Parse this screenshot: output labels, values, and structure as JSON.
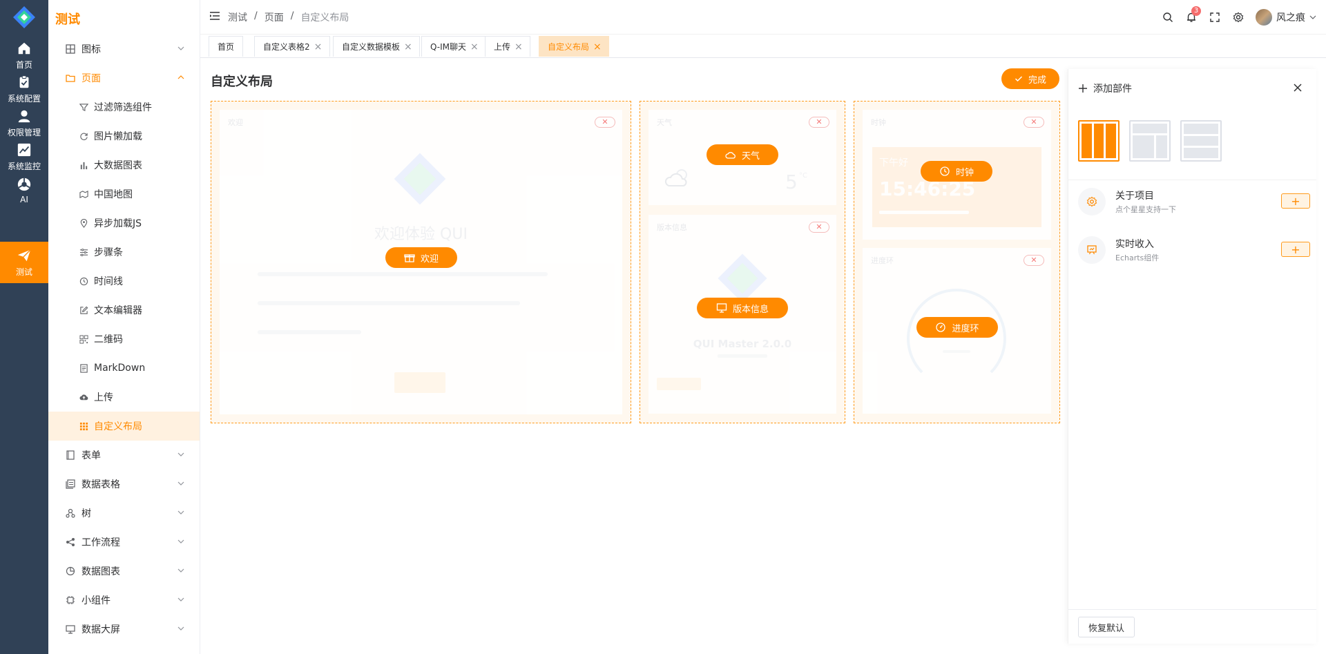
{
  "app": {
    "title": "测试"
  },
  "rail": [
    {
      "label": "首页",
      "icon": "home-icon"
    },
    {
      "label": "系统配置",
      "icon": "clipboard-icon"
    },
    {
      "label": "权限管理",
      "icon": "user-icon"
    },
    {
      "label": "系统监控",
      "icon": "chart-line-icon"
    },
    {
      "label": "AI",
      "icon": "ai-icon"
    },
    {
      "label": "测试",
      "icon": "paper-plane-icon",
      "active": true
    }
  ],
  "menu": {
    "top": [
      {
        "label": "图标"
      },
      {
        "label": "页面"
      }
    ],
    "sub": [
      {
        "label": "过滤筛选组件"
      },
      {
        "label": "图片懒加载"
      },
      {
        "label": "大数据图表"
      },
      {
        "label": "中国地图"
      },
      {
        "label": "异步加载JS"
      },
      {
        "label": "步骤条"
      },
      {
        "label": "时间线"
      },
      {
        "label": "文本编辑器"
      },
      {
        "label": "二维码"
      },
      {
        "label": "MarkDown"
      },
      {
        "label": "上传"
      },
      {
        "label": "自定义布局"
      }
    ],
    "bottom": [
      {
        "label": "表单"
      },
      {
        "label": "数据表格"
      },
      {
        "label": "树"
      },
      {
        "label": "工作流程"
      },
      {
        "label": "数据图表"
      },
      {
        "label": "小组件"
      },
      {
        "label": "数据大屏"
      }
    ]
  },
  "breadcrumb": [
    "测试",
    "页面",
    "自定义布局"
  ],
  "header": {
    "notification_count": "3",
    "user_name": "风之痕"
  },
  "tabs": [
    {
      "label": "首页"
    },
    {
      "label": "自定义表格2"
    },
    {
      "label": "自定义数据模板"
    },
    {
      "label": "Q-IM聊天"
    },
    {
      "label": "上传"
    },
    {
      "label": "自定义布局",
      "active": true
    }
  ],
  "main": {
    "title": "自定义布局",
    "done_label": "完成",
    "widgets": {
      "welcome": {
        "label": "欢迎",
        "card_title": "欢迎",
        "heading": "欢迎体验 QUI"
      },
      "weather": {
        "label": "天气",
        "card_title": "天气",
        "temp": "5",
        "unit": "°C"
      },
      "version": {
        "label": "版本信息",
        "card_title": "版本信息",
        "product": "QUI Master 2.0.0"
      },
      "clock": {
        "label": "时钟",
        "card_title": "时钟",
        "greeting": "下午好",
        "time": "15:46:25"
      },
      "progress": {
        "label": "进度环",
        "card_title": "进度环"
      }
    }
  },
  "panel": {
    "title": "添加部件",
    "items": [
      {
        "title": "关于项目",
        "subtitle": "点个星星支持一下"
      },
      {
        "title": "实时收入",
        "subtitle": "Echarts组件"
      }
    ],
    "reset_label": "恢复默认"
  },
  "colors": {
    "accent": "#ff8a00",
    "rail_bg": "#304156"
  }
}
